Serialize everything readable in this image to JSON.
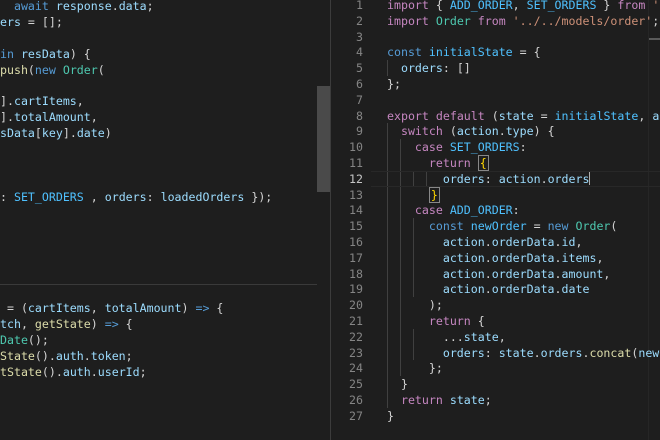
{
  "colors": {
    "background": "#1e1e1e",
    "keyword": "#569cd6",
    "control": "#c586c0",
    "string": "#ce9178",
    "class": "#4ec9b0",
    "function": "#dcdcaa",
    "variable": "#9cdcfe",
    "constant": "#4fc1ff",
    "punctuation": "#d4d4d4",
    "bracket": "#ffd700",
    "line_number": "#858585"
  },
  "left_editor": {
    "lines": [
      [
        [
          "  ",
          "p"
        ],
        [
          "await",
          "kw"
        ],
        [
          " ",
          "p"
        ],
        [
          "response",
          "var"
        ],
        [
          ".",
          "p"
        ],
        [
          "data",
          "var"
        ],
        [
          ";",
          "p"
        ]
      ],
      [
        [
          "ers",
          "var"
        ],
        [
          " = [];",
          "p"
        ]
      ],
      [],
      [
        [
          "in",
          "kw"
        ],
        [
          " ",
          "p"
        ],
        [
          "resData",
          "var"
        ],
        [
          ") {",
          "p"
        ]
      ],
      [
        [
          "push",
          "fn"
        ],
        [
          "(",
          "p"
        ],
        [
          "new",
          "kw"
        ],
        [
          " ",
          "p"
        ],
        [
          "Order",
          "cls"
        ],
        [
          "(",
          "p"
        ]
      ],
      [],
      [
        [
          "].",
          "p"
        ],
        [
          "cartItems",
          "var"
        ],
        [
          ",",
          "p"
        ]
      ],
      [
        [
          "].",
          "p"
        ],
        [
          "totalAmount",
          "var"
        ],
        [
          ",",
          "p"
        ]
      ],
      [
        [
          "sData",
          "var"
        ],
        [
          "[",
          "p"
        ],
        [
          "key",
          "var"
        ],
        [
          "].",
          "p"
        ],
        [
          "date",
          "var"
        ],
        [
          ")",
          "p"
        ]
      ],
      [],
      [],
      [],
      [
        [
          ": ",
          "p"
        ],
        [
          "SET_ORDERS",
          "const"
        ],
        [
          " , ",
          "p"
        ],
        [
          "orders",
          "var"
        ],
        [
          ": ",
          "p"
        ],
        [
          "loadedOrders",
          "var"
        ],
        [
          " });",
          "p"
        ]
      ],
      [],
      [],
      [],
      [],
      [],
      [],
      [
        [
          " = (",
          "p"
        ],
        [
          "cartItems",
          "var"
        ],
        [
          ", ",
          "p"
        ],
        [
          "totalAmount",
          "var"
        ],
        [
          ") ",
          "p"
        ],
        [
          "=>",
          "kw"
        ],
        [
          " {",
          "p"
        ]
      ],
      [
        [
          "tch",
          "var"
        ],
        [
          ", ",
          "p"
        ],
        [
          "getState",
          "fn"
        ],
        [
          ") ",
          "p"
        ],
        [
          "=>",
          "kw"
        ],
        [
          " {",
          "p"
        ]
      ],
      [
        [
          "Date",
          "cls"
        ],
        [
          "();",
          "p"
        ]
      ],
      [
        [
          "State",
          "fn"
        ],
        [
          "().",
          "p"
        ],
        [
          "auth",
          "var"
        ],
        [
          ".",
          "p"
        ],
        [
          "token",
          "var"
        ],
        [
          ";",
          "p"
        ]
      ],
      [
        [
          "tState",
          "fn"
        ],
        [
          "().",
          "p"
        ],
        [
          "auth",
          "var"
        ],
        [
          ".",
          "p"
        ],
        [
          "userId",
          "var"
        ],
        [
          ";",
          "p"
        ]
      ]
    ]
  },
  "right_editor": {
    "active_line": 12,
    "lines": [
      {
        "n": "1",
        "t": [
          [
            "import",
            "ctl"
          ],
          [
            " { ",
            "p"
          ],
          [
            "ADD_ORDER",
            "const"
          ],
          [
            ", ",
            "p"
          ],
          [
            "SET_ORDERS",
            "const"
          ],
          [
            " } ",
            "p"
          ],
          [
            "from",
            "ctl"
          ],
          [
            " ",
            "p"
          ],
          [
            "'../ac",
            "str"
          ]
        ]
      },
      {
        "n": "2",
        "t": [
          [
            "import",
            "ctl"
          ],
          [
            " ",
            "p"
          ],
          [
            "Order",
            "cls"
          ],
          [
            " ",
            "p"
          ],
          [
            "from",
            "ctl"
          ],
          [
            " ",
            "p"
          ],
          [
            "'../../models/order'",
            "str"
          ],
          [
            ";",
            "p"
          ]
        ]
      },
      {
        "n": "3",
        "t": []
      },
      {
        "n": "4",
        "t": [
          [
            "const",
            "kw"
          ],
          [
            " ",
            "p"
          ],
          [
            "initialState",
            "const"
          ],
          [
            " = {",
            "p"
          ]
        ]
      },
      {
        "n": "5",
        "t": [
          [
            "  ",
            "p"
          ],
          [
            "orders",
            "var"
          ],
          [
            ": []",
            "p"
          ]
        ]
      },
      {
        "n": "6",
        "t": [
          [
            "};",
            "p"
          ]
        ]
      },
      {
        "n": "7",
        "t": []
      },
      {
        "n": "8",
        "t": [
          [
            "export",
            "ctl"
          ],
          [
            " ",
            "p"
          ],
          [
            "default",
            "ctl"
          ],
          [
            " (",
            "p"
          ],
          [
            "state",
            "var"
          ],
          [
            " = ",
            "p"
          ],
          [
            "initialState",
            "const"
          ],
          [
            ", ",
            "p"
          ],
          [
            "action",
            "var"
          ]
        ]
      },
      {
        "n": "9",
        "t": [
          [
            "  ",
            "p"
          ],
          [
            "switch",
            "ctl"
          ],
          [
            " (",
            "p"
          ],
          [
            "action",
            "var"
          ],
          [
            ".",
            "p"
          ],
          [
            "type",
            "var"
          ],
          [
            ") {",
            "p"
          ]
        ]
      },
      {
        "n": "10",
        "t": [
          [
            "    ",
            "p"
          ],
          [
            "case",
            "ctl"
          ],
          [
            " ",
            "p"
          ],
          [
            "SET_ORDERS",
            "const"
          ],
          [
            ":",
            "p"
          ]
        ]
      },
      {
        "n": "11",
        "t": [
          [
            "      ",
            "p"
          ],
          [
            "return",
            "ctl"
          ],
          [
            " ",
            "p"
          ],
          [
            "{",
            "bm"
          ]
        ]
      },
      {
        "n": "12",
        "t": [
          [
            "        ",
            "p"
          ],
          [
            "orders",
            "var"
          ],
          [
            ": ",
            "p"
          ],
          [
            "action",
            "var"
          ],
          [
            ".",
            "p"
          ],
          [
            "orders",
            "var"
          ],
          [
            "",
            "cursor"
          ]
        ]
      },
      {
        "n": "13",
        "t": [
          [
            "      ",
            "p"
          ],
          [
            "}",
            "bm"
          ]
        ]
      },
      {
        "n": "14",
        "t": [
          [
            "    ",
            "p"
          ],
          [
            "case",
            "ctl"
          ],
          [
            " ",
            "p"
          ],
          [
            "ADD_ORDER",
            "const"
          ],
          [
            ":",
            "p"
          ]
        ]
      },
      {
        "n": "15",
        "t": [
          [
            "      ",
            "p"
          ],
          [
            "const",
            "kw"
          ],
          [
            " ",
            "p"
          ],
          [
            "newOrder",
            "const"
          ],
          [
            " = ",
            "p"
          ],
          [
            "new",
            "kw"
          ],
          [
            " ",
            "p"
          ],
          [
            "Order",
            "cls"
          ],
          [
            "(",
            "p"
          ]
        ]
      },
      {
        "n": "16",
        "t": [
          [
            "        ",
            "p"
          ],
          [
            "action",
            "var"
          ],
          [
            ".",
            "p"
          ],
          [
            "orderData",
            "var"
          ],
          [
            ".",
            "p"
          ],
          [
            "id",
            "var"
          ],
          [
            ",",
            "p"
          ]
        ]
      },
      {
        "n": "17",
        "t": [
          [
            "        ",
            "p"
          ],
          [
            "action",
            "var"
          ],
          [
            ".",
            "p"
          ],
          [
            "orderData",
            "var"
          ],
          [
            ".",
            "p"
          ],
          [
            "items",
            "var"
          ],
          [
            ",",
            "p"
          ]
        ]
      },
      {
        "n": "18",
        "t": [
          [
            "        ",
            "p"
          ],
          [
            "action",
            "var"
          ],
          [
            ".",
            "p"
          ],
          [
            "orderData",
            "var"
          ],
          [
            ".",
            "p"
          ],
          [
            "amount",
            "var"
          ],
          [
            ",",
            "p"
          ]
        ]
      },
      {
        "n": "19",
        "t": [
          [
            "        ",
            "p"
          ],
          [
            "action",
            "var"
          ],
          [
            ".",
            "p"
          ],
          [
            "orderData",
            "var"
          ],
          [
            ".",
            "p"
          ],
          [
            "date",
            "var"
          ]
        ]
      },
      {
        "n": "20",
        "t": [
          [
            "      ",
            "p"
          ],
          [
            ");",
            "p"
          ]
        ]
      },
      {
        "n": "21",
        "t": [
          [
            "      ",
            "p"
          ],
          [
            "return",
            "ctl"
          ],
          [
            " {",
            "p"
          ]
        ]
      },
      {
        "n": "22",
        "t": [
          [
            "        ",
            "p"
          ],
          [
            "...",
            "p"
          ],
          [
            "state",
            "var"
          ],
          [
            ",",
            "p"
          ]
        ]
      },
      {
        "n": "23",
        "t": [
          [
            "        ",
            "p"
          ],
          [
            "orders",
            "var"
          ],
          [
            ": ",
            "p"
          ],
          [
            "state",
            "var"
          ],
          [
            ".",
            "p"
          ],
          [
            "orders",
            "var"
          ],
          [
            ".",
            "p"
          ],
          [
            "concat",
            "fn"
          ],
          [
            "(",
            "p"
          ],
          [
            "newOrde",
            "var"
          ]
        ]
      },
      {
        "n": "24",
        "t": [
          [
            "      ",
            "p"
          ],
          [
            "};",
            "p"
          ]
        ]
      },
      {
        "n": "25",
        "t": [
          [
            "  ",
            "p"
          ],
          [
            "}",
            "p"
          ]
        ]
      },
      {
        "n": "26",
        "t": [
          [
            "  ",
            "p"
          ],
          [
            "return",
            "ctl"
          ],
          [
            " ",
            "p"
          ],
          [
            "state",
            "var"
          ],
          [
            ";",
            "p"
          ]
        ]
      },
      {
        "n": "27",
        "t": [
          [
            "}",
            "p"
          ]
        ]
      }
    ]
  }
}
